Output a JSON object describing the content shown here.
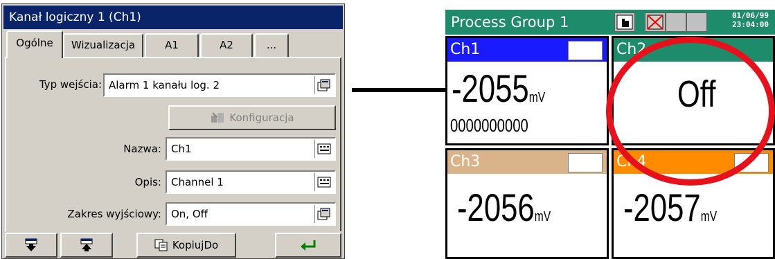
{
  "dialog": {
    "title": "Kanał logiczny 1 (Ch1)",
    "tabs": [
      "Ogólne",
      "Wizualizacja",
      "A1",
      "A2",
      "..."
    ],
    "fields": {
      "input_type_label": "Typ wejścia:",
      "input_type_value": "Alarm 1 kanału log. 2",
      "config_button": "Konfiguracja",
      "name_label": "Nazwa:",
      "name_value": "Ch1",
      "desc_label": "Opis:",
      "desc_value": "Channel 1",
      "range_label": "Zakres wyjściowy:",
      "range_value": "On, Off"
    },
    "footer": {
      "copy_to": "KopiujDo"
    }
  },
  "recorder": {
    "group_title": "Process Group 1",
    "date": "01/06/99",
    "time": "23:04:00",
    "channels": [
      {
        "name": "Ch1",
        "value": "-2055",
        "unit": "mV",
        "extra": "0000000000",
        "color": "#1a1aff"
      },
      {
        "name": "Ch2",
        "value": "Off",
        "color": "#1e8c6a"
      },
      {
        "name": "Ch3",
        "value": "-2056",
        "unit": "mV",
        "color": "#d9b48a"
      },
      {
        "name": "Ch4",
        "value": "-2057",
        "unit": "mV",
        "color": "#ff8c00"
      }
    ]
  },
  "colors": {
    "title_bar": "#0a246a",
    "recorder_header": "#1e8c6a",
    "highlight_circle": "#e8101a"
  }
}
